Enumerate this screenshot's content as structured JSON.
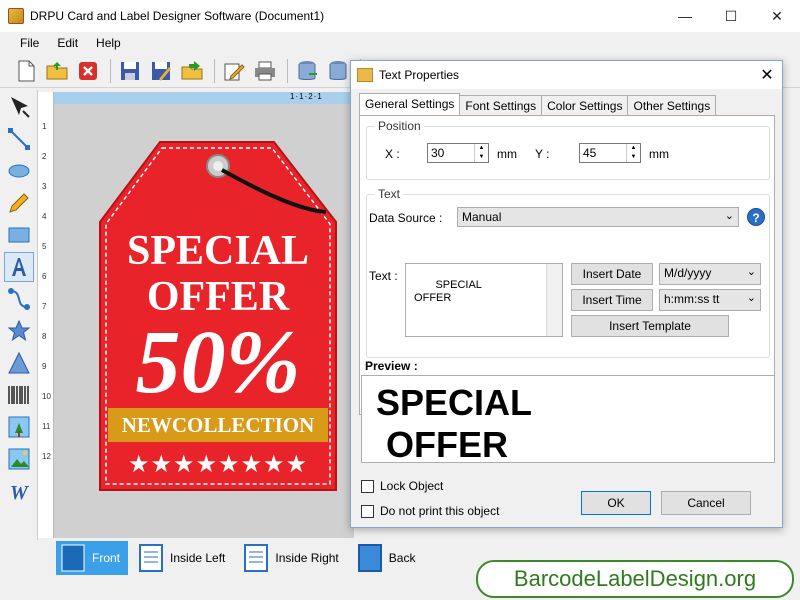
{
  "window": {
    "title": "DRPU Card and Label Designer Software (Document1)",
    "minimize": "—",
    "maximize": "☐",
    "close": "✕"
  },
  "menu": {
    "file": "File",
    "edit": "Edit",
    "help": "Help"
  },
  "canvas": {
    "tag_line1": "SPECIAL",
    "tag_line2": "OFFER",
    "tag_percent": "50%",
    "tag_band": "NEWCOLLECTION",
    "tag_stars": "★★★★★★★★",
    "tag_color": "#e8242a",
    "band_color": "#d89a18",
    "ruler_top": "1·1·2·1"
  },
  "ruler_vertical": [
    "1",
    "2",
    "3",
    "4",
    "5",
    "6",
    "7",
    "8",
    "9",
    "10",
    "11",
    "12"
  ],
  "pages": {
    "front": "Front",
    "inside_left": "Inside Left",
    "inside_right": "Inside Right",
    "back": "Back"
  },
  "watermark": "BarcodeLabelDesign.org",
  "dialog": {
    "title": "Text Properties",
    "close": "✕",
    "tabs": [
      "General Settings",
      "Font Settings",
      "Color Settings",
      "Other Settings"
    ],
    "position_group": "Position",
    "x_label": "X :",
    "x_value": "30",
    "x_unit": "mm",
    "y_label": "Y :",
    "y_value": "45",
    "y_unit": "mm",
    "text_group": "Text",
    "data_source_label": "Data Source :",
    "data_source_value": "Manual",
    "help": "?",
    "text_label": "Text :",
    "text_value": "SPECIAL\n OFFER",
    "insert_date": "Insert Date",
    "date_format": "M/d/yyyy",
    "insert_time": "Insert Time",
    "time_format": "h:mm:ss tt",
    "insert_template": "Insert Template",
    "preview_label": "Preview :",
    "preview_text": "SPECIAL\n OFFER",
    "lock_object": "Lock Object",
    "no_print": "Do not print this object",
    "ok": "OK",
    "cancel": "Cancel"
  }
}
